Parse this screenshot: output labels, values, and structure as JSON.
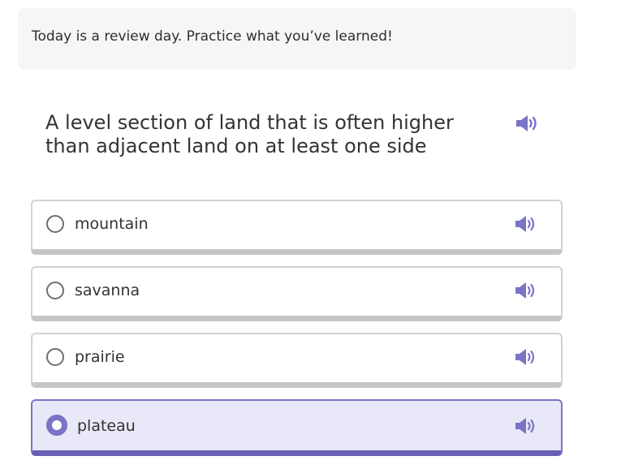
{
  "banner": {
    "text": "Today is a review day. Practice what you’ve learned!"
  },
  "question": {
    "prompt": "A level section of land that is often higher than adjacent land on at least one side",
    "audio_icon": "speaker-icon"
  },
  "choices": [
    {
      "label": "mountain",
      "selected": false,
      "audio_icon": "speaker-icon"
    },
    {
      "label": "savanna",
      "selected": false,
      "audio_icon": "speaker-icon"
    },
    {
      "label": "prairie",
      "selected": false,
      "audio_icon": "speaker-icon"
    },
    {
      "label": "plateau",
      "selected": true,
      "audio_icon": "speaker-icon"
    }
  ],
  "colors": {
    "accent": "#7a74c6",
    "speaker": "#7a74c6",
    "selected_background": "#e8e8f8",
    "banner_background": "#f6f6f6"
  }
}
